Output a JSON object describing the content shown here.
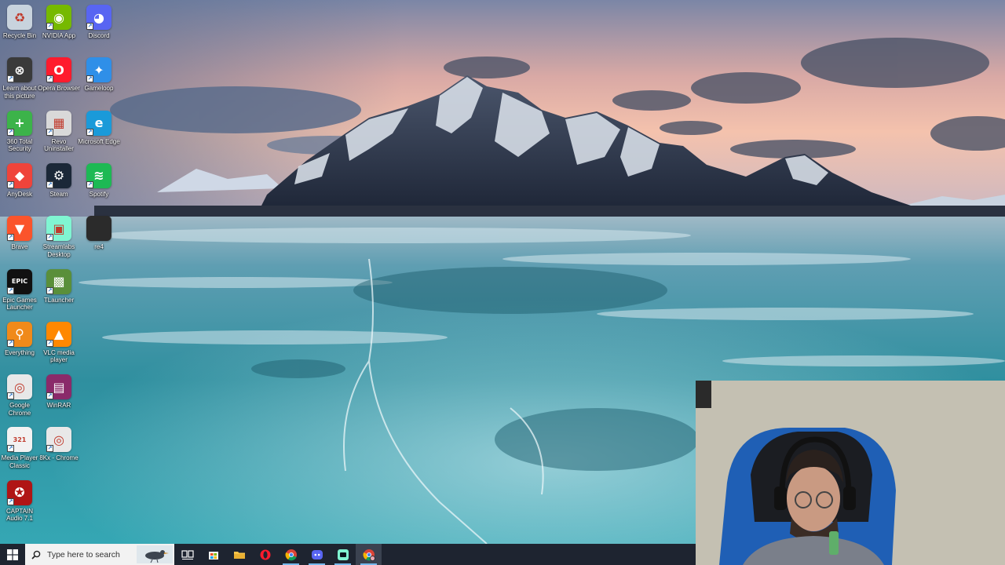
{
  "desktop": {
    "icons": [
      {
        "label": "Recycle Bin",
        "icon": "recycle-bin-icon",
        "color": "#c8d3dd",
        "glyph": "♻",
        "shortcut": false
      },
      {
        "label": "NVIDIA App",
        "icon": "nvidia-icon",
        "color": "#76b900",
        "glyph": "◉",
        "shortcut": true
      },
      {
        "label": "Discord",
        "icon": "discord-icon",
        "color": "#5865f2",
        "glyph": "◕",
        "shortcut": true
      },
      {
        "label": "Learn about this picture",
        "icon": "learn-picture-icon",
        "color": "#3a3a3a",
        "glyph": "⊗",
        "shortcut": true
      },
      {
        "label": "Opera Browser",
        "icon": "opera-icon",
        "color": "#ff1b2d",
        "glyph": "O",
        "shortcut": true
      },
      {
        "label": "Gameloop",
        "icon": "gameloop-icon",
        "color": "#2f8fe8",
        "glyph": "✦",
        "shortcut": true
      },
      {
        "label": "360 Total Security",
        "icon": "360-security-icon",
        "color": "#3cb34a",
        "glyph": "+",
        "shortcut": true
      },
      {
        "label": "Revo Uninstaller",
        "icon": "revo-uninstaller-icon",
        "color": "#d9d9d9",
        "glyph": "▦",
        "shortcut": true
      },
      {
        "label": "Microsoft Edge",
        "icon": "edge-icon",
        "color": "#1a9ad9",
        "glyph": "e",
        "shortcut": true
      },
      {
        "label": "AnyDesk",
        "icon": "anydesk-icon",
        "color": "#ef443b",
        "glyph": "◆",
        "shortcut": true
      },
      {
        "label": "Steam",
        "icon": "steam-icon",
        "color": "#1b2838",
        "glyph": "⚙",
        "shortcut": true
      },
      {
        "label": "Spotify",
        "icon": "spotify-icon",
        "color": "#1db954",
        "glyph": "≋",
        "shortcut": true
      },
      {
        "label": "Brave",
        "icon": "brave-icon",
        "color": "#fb542b",
        "glyph": "▼",
        "shortcut": true
      },
      {
        "label": "Streamlabs Desktop",
        "icon": "streamlabs-icon",
        "color": "#80f5d2",
        "glyph": "▣",
        "shortcut": true
      },
      {
        "label": "re4",
        "icon": "re4-folder-icon",
        "color": "#2b2b2b",
        "glyph": "",
        "shortcut": false
      },
      {
        "label": "Epic Games Launcher",
        "icon": "epic-games-icon",
        "color": "#111111",
        "glyph": "EPIC",
        "shortcut": true
      },
      {
        "label": "TLauncher",
        "icon": "tlauncher-icon",
        "color": "#5a8f3a",
        "glyph": "▩",
        "shortcut": true
      },
      {
        "label": "",
        "icon": "empty-slot",
        "color": "",
        "glyph": "",
        "shortcut": false
      },
      {
        "label": "Everything",
        "icon": "everything-search-icon",
        "color": "#f08a1a",
        "glyph": "⚲",
        "shortcut": true
      },
      {
        "label": "VLC media player",
        "icon": "vlc-icon",
        "color": "#ff8800",
        "glyph": "▲",
        "shortcut": true
      },
      {
        "label": "",
        "icon": "empty-slot",
        "color": "",
        "glyph": "",
        "shortcut": false
      },
      {
        "label": "Google Chrome",
        "icon": "chrome-icon",
        "color": "#e8e8e8",
        "glyph": "◎",
        "shortcut": true
      },
      {
        "label": "WinRAR",
        "icon": "winrar-icon",
        "color": "#8a2a6a",
        "glyph": "▤",
        "shortcut": true
      },
      {
        "label": "",
        "icon": "empty-slot",
        "color": "",
        "glyph": "",
        "shortcut": false
      },
      {
        "label": "Media Player Classic",
        "icon": "mpc-icon",
        "color": "#f2f2f2",
        "glyph": "321",
        "shortcut": true
      },
      {
        "label": "8Kx - Chrome",
        "icon": "chrome-profile-icon",
        "color": "#e8e8e8",
        "glyph": "◎",
        "shortcut": true
      },
      {
        "label": "",
        "icon": "empty-slot",
        "color": "",
        "glyph": "",
        "shortcut": false
      },
      {
        "label": "CAPTAIN Audio 7.1",
        "icon": "captain-audio-icon",
        "color": "#b01515",
        "glyph": "✪",
        "shortcut": true
      }
    ]
  },
  "taskbar": {
    "search_placeholder": "Type here to search",
    "apps": [
      {
        "name": "task-view-button",
        "icon": "task-view-icon",
        "running": false,
        "active": false
      },
      {
        "name": "store-button",
        "icon": "store-icon",
        "running": false,
        "active": false
      },
      {
        "name": "file-explorer-button",
        "icon": "folder-icon",
        "running": false,
        "active": false
      },
      {
        "name": "opera-taskbar-button",
        "icon": "opera-icon",
        "running": false,
        "active": false
      },
      {
        "name": "chrome-taskbar-button",
        "icon": "chrome-icon",
        "running": true,
        "active": false
      },
      {
        "name": "discord-taskbar-button",
        "icon": "discord-icon",
        "running": true,
        "active": false
      },
      {
        "name": "streamlabs-taskbar-button",
        "icon": "streamlabs-icon",
        "running": true,
        "active": false
      },
      {
        "name": "chrome-profile-taskbar-button",
        "icon": "chrome-profile-icon",
        "running": true,
        "active": true
      }
    ]
  },
  "colors": {
    "taskbar_bg": "#1e2430",
    "running_indicator": "#76b9ed",
    "sky_top": "#6f7fa0",
    "sky_glow": "#f3b9a5",
    "ice": "#3fa4ad"
  }
}
